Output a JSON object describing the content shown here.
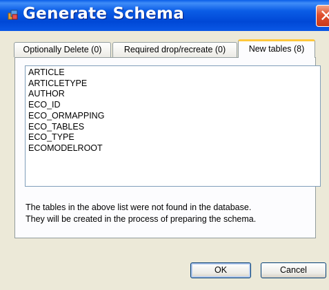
{
  "window": {
    "title": "Generate Schema",
    "icon": "schema-app-icon",
    "close_glyph": "✕"
  },
  "tabs": [
    {
      "label": "Optionally Delete (0)",
      "active": false
    },
    {
      "label": "Required drop/recreate (0)",
      "active": false
    },
    {
      "label": "New tables (8)",
      "active": true
    }
  ],
  "new_tables": {
    "items": [
      "ARTICLE",
      "ARTICLETYPE",
      "AUTHOR",
      "ECO_ID",
      "ECO_ORMAPPING",
      "ECO_TABLES",
      "ECO_TYPE",
      "ECOMODELROOT"
    ],
    "info_line1": "The tables in the above list were not found in the database.",
    "info_line2": "They will be created in the process of preparing the schema."
  },
  "buttons": {
    "ok_label": "OK",
    "cancel_label": "Cancel"
  },
  "colors": {
    "titlebar": "#0054e3",
    "close_button": "#e0502e",
    "dialog_face": "#ece9d8",
    "active_tab_accent": "#ffc83c"
  }
}
